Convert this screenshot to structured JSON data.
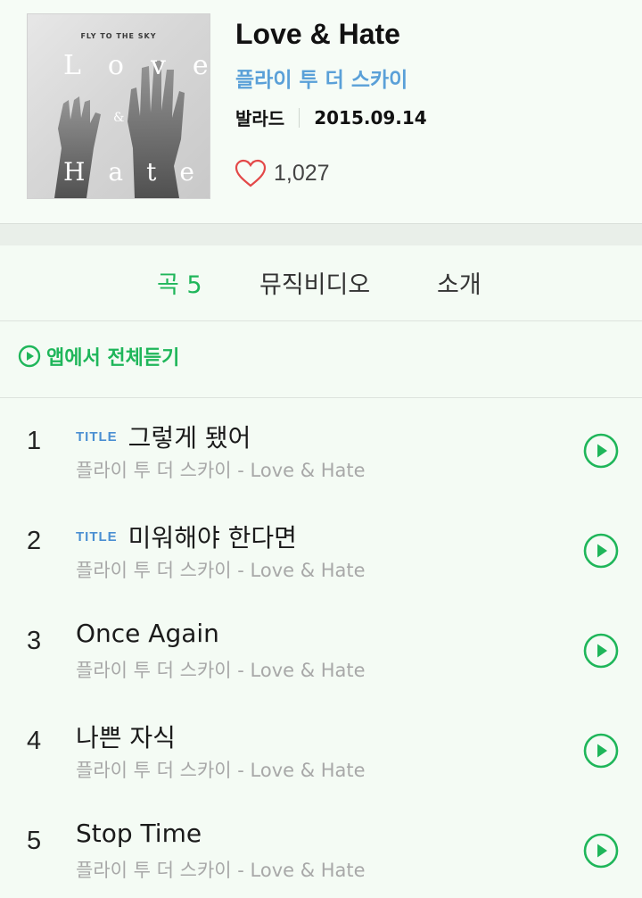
{
  "album": {
    "cover_band_text": "FLY TO THE SKY",
    "cover_text_love": "Love",
    "cover_text_amp": "&",
    "cover_text_hate": "Hate",
    "title": "Love & Hate",
    "artist": "플라이 투 더 스카이",
    "genre": "발라드",
    "release_date": "2015.09.14",
    "likes": "1,027"
  },
  "tabs": [
    {
      "label": "곡 5",
      "active": true
    },
    {
      "label": "뮤직비디오",
      "active": false
    },
    {
      "label": "소개",
      "active": false
    }
  ],
  "play_all_label": "앱에서 전체듣기",
  "tracks": [
    {
      "number": "1",
      "badge": "TITLE",
      "title": "그렇게 됐어",
      "subtitle": "플라이 투 더 스카이 - Love & Hate"
    },
    {
      "number": "2",
      "badge": "TITLE",
      "title": "미워해야 한다면",
      "subtitle": "플라이 투 더 스카이 - Love & Hate"
    },
    {
      "number": "3",
      "badge": "",
      "title": "Once Again",
      "subtitle": "플라이 투 더 스카이 - Love & Hate"
    },
    {
      "number": "4",
      "badge": "",
      "title": "나쁜 자식",
      "subtitle": "플라이 투 더 스카이 - Love & Hate"
    },
    {
      "number": "5",
      "badge": "",
      "title": "Stop Time",
      "subtitle": "플라이 투 더 스카이 - Love & Hate"
    }
  ],
  "icons": {
    "like": "heart-outline-icon",
    "play_all": "play-circle-icon",
    "track_play": "play-circle-icon"
  },
  "colors": {
    "accent_green": "#1fb65a",
    "artist_blue": "#5aa0d8",
    "badge_blue": "#4a8fd2",
    "heart_red": "#e34848"
  }
}
